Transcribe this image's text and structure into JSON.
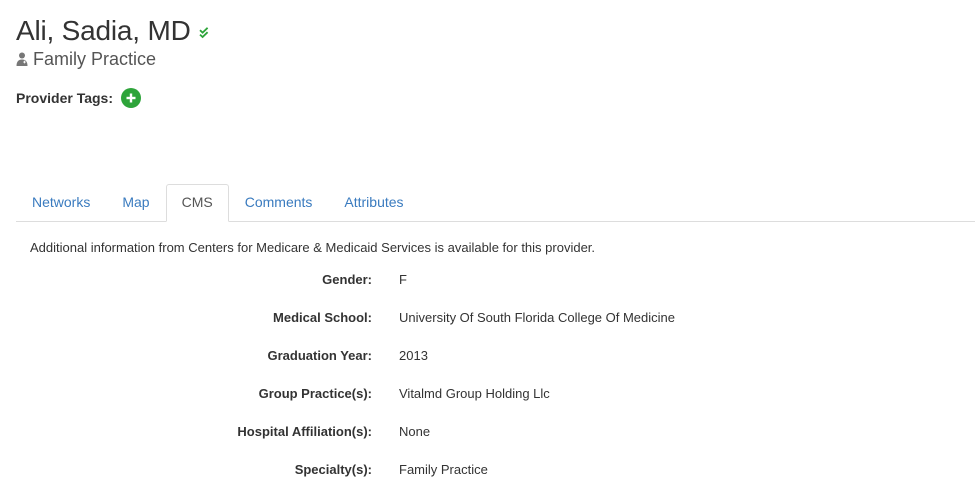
{
  "provider": {
    "name": "Ali, Sadia, MD",
    "specialty": "Family Practice"
  },
  "tags": {
    "label": "Provider Tags:"
  },
  "tabs": [
    {
      "label": "Networks"
    },
    {
      "label": "Map"
    },
    {
      "label": "CMS"
    },
    {
      "label": "Comments"
    },
    {
      "label": "Attributes"
    }
  ],
  "active_tab": "CMS",
  "cms": {
    "info": "Additional information from Centers for Medicare & Medicaid Services is available for this provider.",
    "rows": [
      {
        "label": "Gender:",
        "value": "F"
      },
      {
        "label": "Medical School:",
        "value": "University Of South Florida College Of Medicine"
      },
      {
        "label": "Graduation Year:",
        "value": "2013"
      },
      {
        "label": "Group Practice(s):",
        "value": "Vitalmd Group Holding Llc"
      },
      {
        "label": "Hospital Affiliation(s):",
        "value": "None"
      },
      {
        "label": "Specialty(s):",
        "value": "Family Practice"
      }
    ]
  },
  "colors": {
    "link": "#3a7bbf",
    "verified": "#2ea43a",
    "add_button": "#2ea43a"
  },
  "icons": {
    "verified": "double-check-icon",
    "specialty": "doctor-icon",
    "add_tag": "plus-circle-icon"
  }
}
